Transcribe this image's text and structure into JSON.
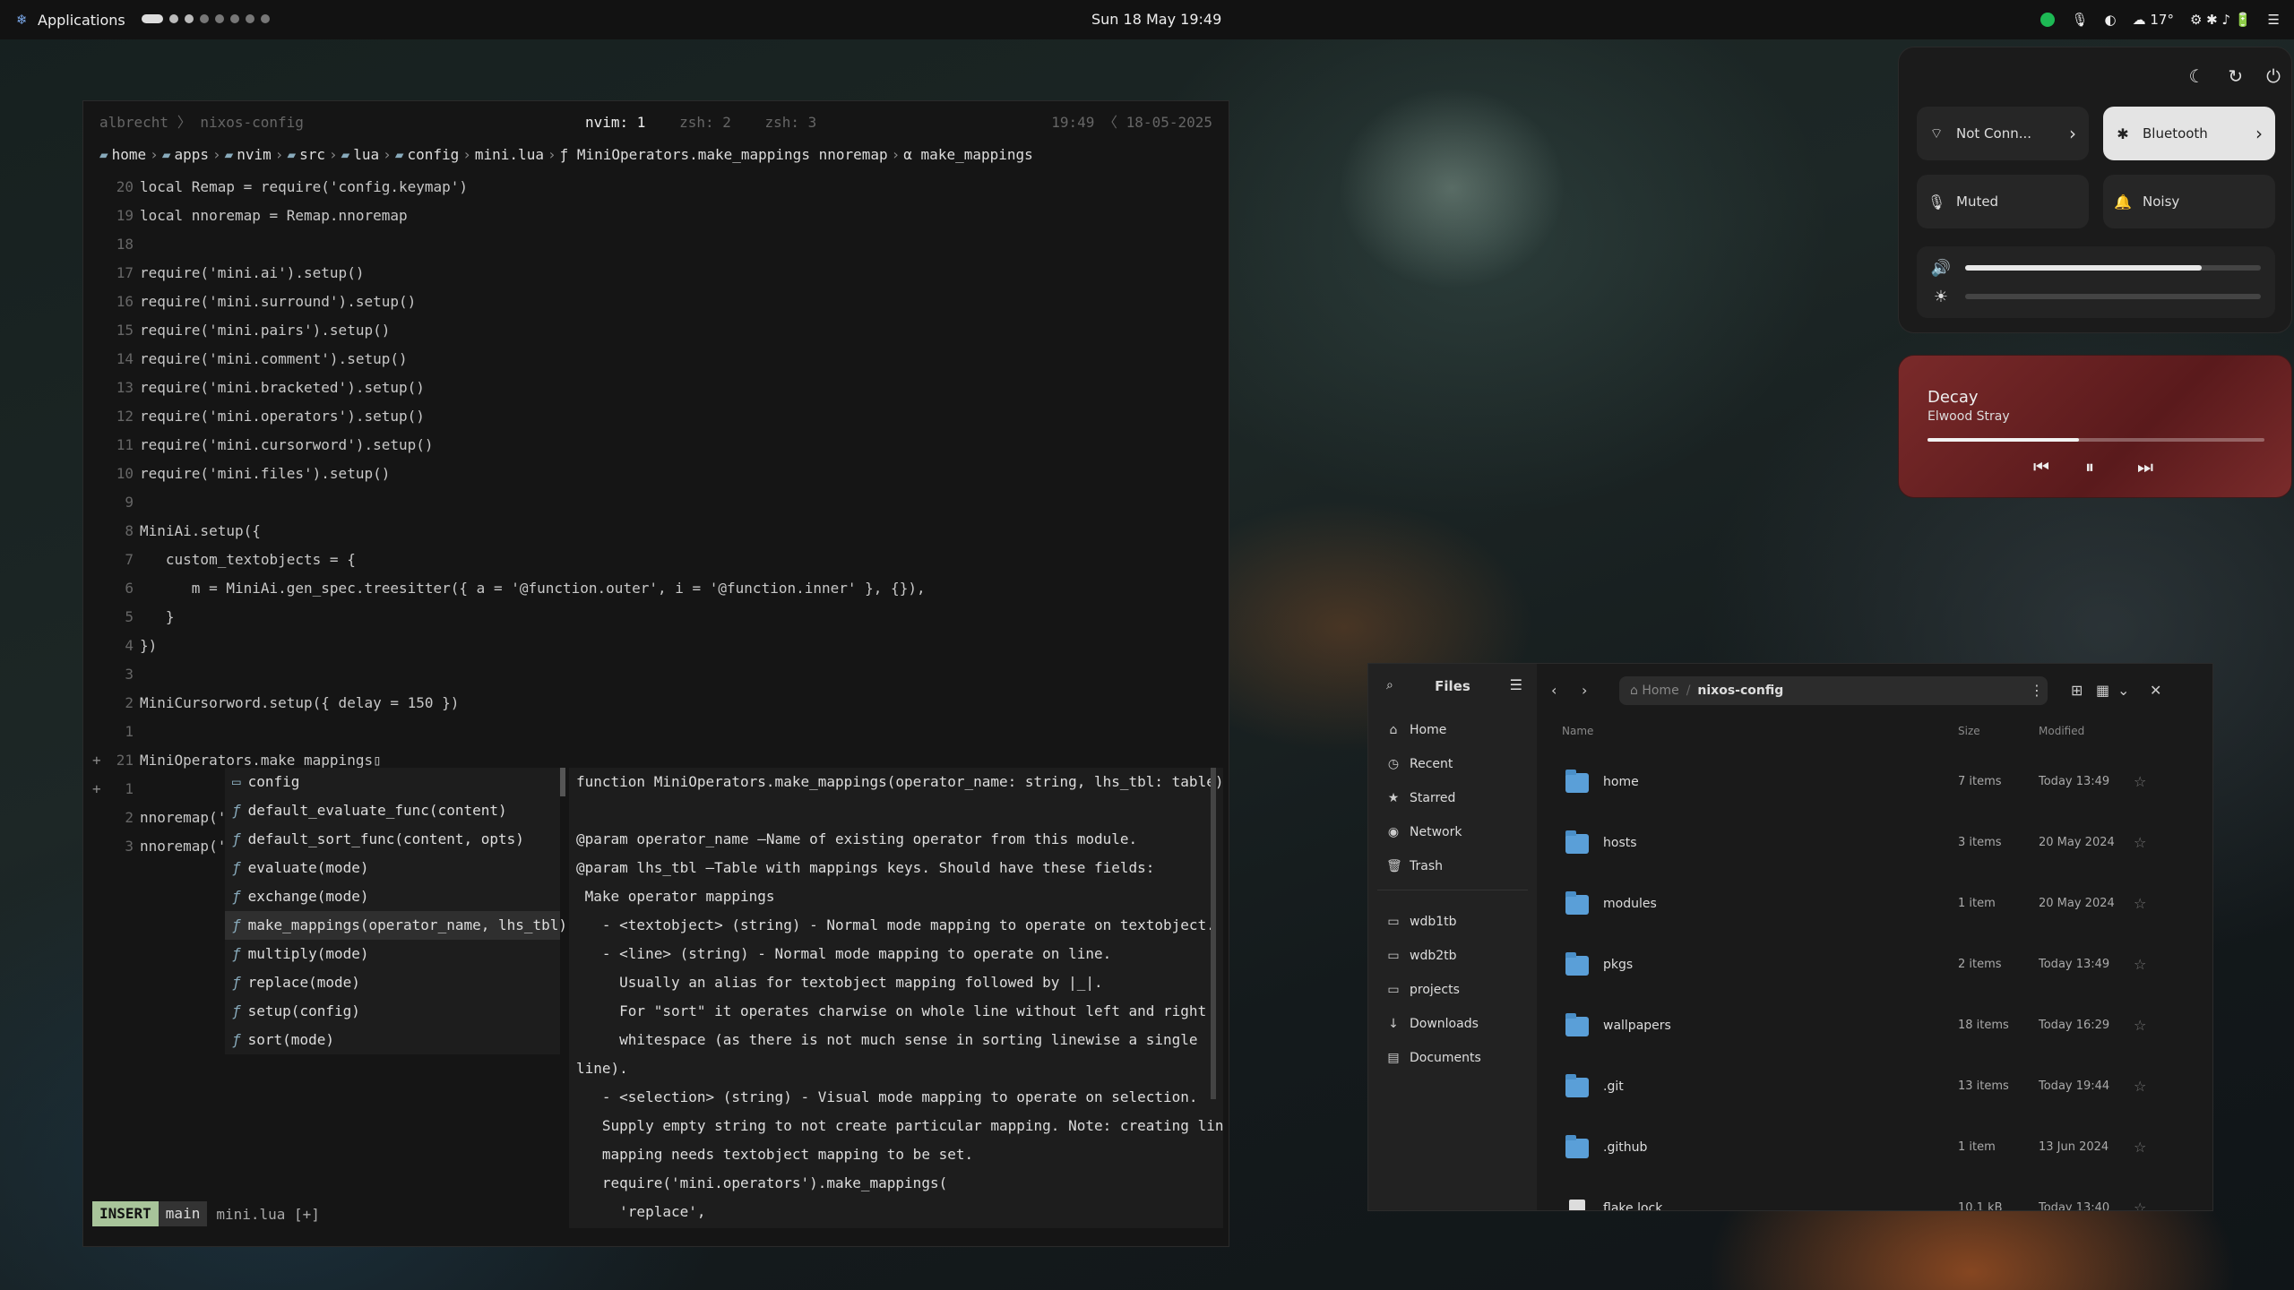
{
  "topbar": {
    "apps_label": "Applications",
    "clock": "Sun 18 May  19:49",
    "weather": "17°"
  },
  "terminal": {
    "tmux_left": "albrecht 〉 nixos-config",
    "tabs": [
      {
        "label": "nvim: 1",
        "active": true
      },
      {
        "label": "zsh: 2",
        "active": false
      },
      {
        "label": "zsh: 3",
        "active": false
      }
    ],
    "tmux_right": "19:49 〈 18-05-2025",
    "breadcrumbs": [
      "home",
      "apps",
      "nvim",
      "src",
      "lua",
      "config",
      "mini.lua",
      "ƒ MiniOperators.make_mappings nnoremap",
      "α make_mappings"
    ],
    "lines": [
      {
        "n": "20",
        "t": "local Remap = require('config.keymap')"
      },
      {
        "n": "19",
        "t": "local nnoremap = Remap.nnoremap"
      },
      {
        "n": "18",
        "t": ""
      },
      {
        "n": "17",
        "t": "require('mini.ai').setup()"
      },
      {
        "n": "16",
        "t": "require('mini.surround').setup()"
      },
      {
        "n": "15",
        "t": "require('mini.pairs').setup()"
      },
      {
        "n": "14",
        "t": "require('mini.comment').setup()"
      },
      {
        "n": "13",
        "t": "require('mini.bracketed').setup()"
      },
      {
        "n": "12",
        "t": "require('mini.operators').setup()"
      },
      {
        "n": "11",
        "t": "require('mini.cursorword').setup()"
      },
      {
        "n": "10",
        "t": "require('mini.files').setup()"
      },
      {
        "n": "9",
        "t": ""
      },
      {
        "n": "8",
        "t": "MiniAi.setup({"
      },
      {
        "n": "7",
        "t": "   custom_textobjects = {"
      },
      {
        "n": "6",
        "t": "      m = MiniAi.gen_spec.treesitter({ a = '@function.outer', i = '@function.inner' }, {}),"
      },
      {
        "n": "5",
        "t": "   }"
      },
      {
        "n": "4",
        "t": "})"
      },
      {
        "n": "3",
        "t": ""
      },
      {
        "n": "2",
        "t": "MiniCursorword.setup({ delay = 150 })"
      },
      {
        "n": "1",
        "t": ""
      },
      {
        "n": "21",
        "t": "MiniOperators.make_mappings▯",
        "sign": "+"
      },
      {
        "n": "1",
        "t": "",
        "sign": "+"
      },
      {
        "n": "2",
        "t": "nnoremap('<"
      },
      {
        "n": "3",
        "t": "nnoremap('<"
      }
    ],
    "completion": [
      {
        "kind": "▭",
        "label": "config"
      },
      {
        "kind": "ƒ",
        "label": "default_evaluate_func(content)"
      },
      {
        "kind": "ƒ",
        "label": "default_sort_func(content, opts)"
      },
      {
        "kind": "ƒ",
        "label": "evaluate(mode)"
      },
      {
        "kind": "ƒ",
        "label": "exchange(mode)"
      },
      {
        "kind": "ƒ",
        "label": "make_mappings(operator_name, lhs_tbl)",
        "selected": true
      },
      {
        "kind": "ƒ",
        "label": "multiply(mode)"
      },
      {
        "kind": "ƒ",
        "label": "replace(mode)"
      },
      {
        "kind": "ƒ",
        "label": "setup(config)"
      },
      {
        "kind": "ƒ",
        "label": "sort(mode)"
      }
    ],
    "doc": [
      "function MiniOperators.make_mappings(operator_name: string, lhs_tbl: table)",
      "",
      "@param operator_name —Name of existing operator from this module.",
      "@param lhs_tbl —Table with mappings keys. Should have these fields:",
      " Make operator mappings",
      "   - <textobject> (string) - Normal mode mapping to operate on textobject.",
      "   - <line> (string) - Normal mode mapping to operate on line.",
      "     Usually an alias for textobject mapping followed by |_|.",
      "     For \"sort\" it operates charwise on whole line without left and right",
      "     whitespace (as there is not much sense in sorting linewise a single",
      "line).",
      "   - <selection> (string) - Visual mode mapping to operate on selection.",
      "   Supply empty string to not create particular mapping. Note: creating line",
      "   mapping needs textobject mapping to be set.",
      "   require('mini.operators').make_mappings(",
      "     'replace',"
    ],
    "status": {
      "mode": "INSERT",
      "branch": " main",
      "file": "mini.lua [+]"
    }
  },
  "quick_settings": {
    "wifi": "Not Conn...",
    "bluetooth": "Bluetooth",
    "mic": "Muted",
    "noise": "Noisy",
    "volume": 0.8,
    "brightness": 0.0
  },
  "media": {
    "title": "Decay",
    "artist": "Elwood Stray",
    "progress": 0.45
  },
  "files": {
    "title": "Files",
    "places": [
      "Home",
      "Recent",
      "Starred",
      "Network",
      "Trash"
    ],
    "bookmarks": [
      "wdb1tb",
      "wdb2tb",
      "projects",
      "Downloads",
      "Documents"
    ],
    "path_home": "Home",
    "path_current": "nixos-config",
    "columns": {
      "name": "Name",
      "size": "Size",
      "modified": "Modified"
    },
    "rows": [
      {
        "name": "home",
        "size": "7 items",
        "modified": "Today 13:49",
        "type": "folder"
      },
      {
        "name": "hosts",
        "size": "3 items",
        "modified": "20 May 2024",
        "type": "folder"
      },
      {
        "name": "modules",
        "size": "1 item",
        "modified": "20 May 2024",
        "type": "folder"
      },
      {
        "name": "pkgs",
        "size": "2 items",
        "modified": "Today 13:49",
        "type": "folder"
      },
      {
        "name": "wallpapers",
        "size": "18 items",
        "modified": "Today 16:29",
        "type": "folder"
      },
      {
        "name": ".git",
        "size": "13 items",
        "modified": "Today 19:44",
        "type": "folder"
      },
      {
        "name": ".github",
        "size": "1 item",
        "modified": "13 Jun 2024",
        "type": "folder"
      },
      {
        "name": "flake.lock",
        "size": "10.1 kB",
        "modified": "Today 13:40",
        "type": "file"
      }
    ]
  }
}
